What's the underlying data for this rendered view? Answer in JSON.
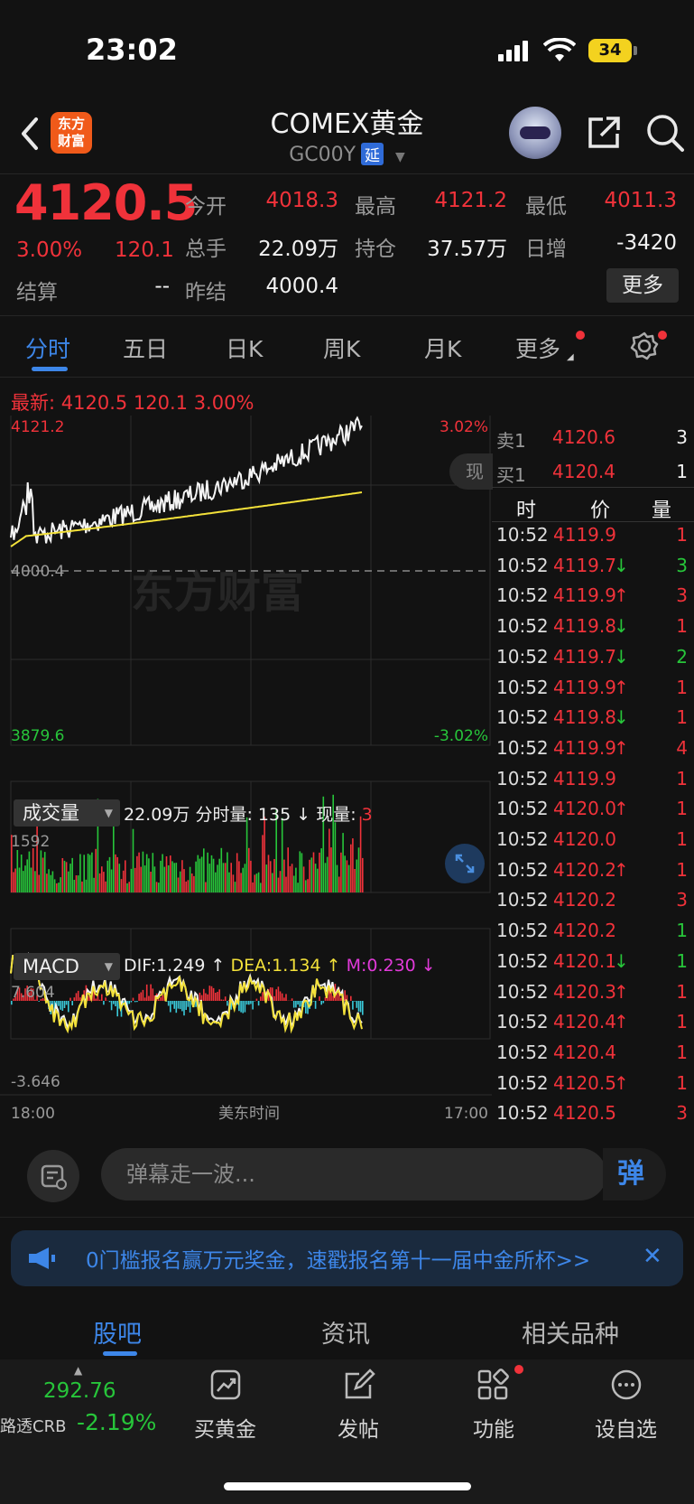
{
  "status": {
    "time": "23:02",
    "battery": "34"
  },
  "header": {
    "logo": "东方\n财富",
    "title": "COMEX黄金",
    "subtitle": "GC00Y",
    "delay_badge": "延"
  },
  "quote": {
    "price": "4120.5",
    "pct": "3.00%",
    "change": "120.1",
    "open_label": "今开",
    "open": "4018.3",
    "high_label": "最高",
    "high": "4121.2",
    "low_label": "最低",
    "low": "4011.3",
    "volume_label": "总手",
    "volume": "22.09万",
    "oi_label": "持仓",
    "oi": "37.57万",
    "daily_inc_label": "日增",
    "daily_inc": "-3420",
    "settle_label": "结算",
    "settle": "--",
    "prev_settle_label": "昨结",
    "prev_settle": "4000.4",
    "more": "更多"
  },
  "tabs": [
    "分时",
    "五日",
    "日K",
    "周K",
    "月K",
    "更多"
  ],
  "latest": "最新: 4120.5  120.1  3.00%",
  "chart_labels": {
    "y_top": "4121.2",
    "y_mid": "4000.4",
    "y_bot": "3879.6",
    "pct_top": "3.02%",
    "pct_bot": "-3.02%",
    "vol_max": "1592",
    "macd_top": "7.604",
    "macd_bot": "-3.646",
    "x_start": "18:00",
    "x_mid": "美东时间",
    "x_end": "17:00",
    "side_tag": "现"
  },
  "volume_header": {
    "tab": "成交量",
    "total": "22.09万",
    "tick_label": "分时量:",
    "tick": "135",
    "cur_label": "现量:",
    "cur": "3"
  },
  "macd_header": {
    "tab": "MACD",
    "dif": "DIF:1.249",
    "dea": "DEA:1.134",
    "m": "M:0.230"
  },
  "orderbook": {
    "ask_label": "卖1",
    "ask_price": "4120.6",
    "ask_qty": "3",
    "bid_label": "买1",
    "bid_price": "4120.4",
    "bid_qty": "1",
    "headers": [
      "时",
      "价",
      "量"
    ],
    "trades": [
      {
        "time": "10:52",
        "price": "4119.9",
        "arrow": "",
        "qty": "1",
        "qc": "red"
      },
      {
        "time": "10:52",
        "price": "4119.7",
        "arrow": "↓",
        "qty": "3",
        "qc": "green"
      },
      {
        "time": "10:52",
        "price": "4119.9",
        "arrow": "↑",
        "qty": "3",
        "qc": "red"
      },
      {
        "time": "10:52",
        "price": "4119.8",
        "arrow": "↓",
        "qty": "1",
        "qc": "red"
      },
      {
        "time": "10:52",
        "price": "4119.7",
        "arrow": "↓",
        "qty": "2",
        "qc": "green"
      },
      {
        "time": "10:52",
        "price": "4119.9",
        "arrow": "↑",
        "qty": "1",
        "qc": "red"
      },
      {
        "time": "10:52",
        "price": "4119.8",
        "arrow": "↓",
        "qty": "1",
        "qc": "red"
      },
      {
        "time": "10:52",
        "price": "4119.9",
        "arrow": "↑",
        "qty": "4",
        "qc": "red"
      },
      {
        "time": "10:52",
        "price": "4119.9",
        "arrow": "",
        "qty": "1",
        "qc": "red"
      },
      {
        "time": "10:52",
        "price": "4120.0",
        "arrow": "↑",
        "qty": "1",
        "qc": "red"
      },
      {
        "time": "10:52",
        "price": "4120.0",
        "arrow": "",
        "qty": "1",
        "qc": "red"
      },
      {
        "time": "10:52",
        "price": "4120.2",
        "arrow": "↑",
        "qty": "1",
        "qc": "red"
      },
      {
        "time": "10:52",
        "price": "4120.2",
        "arrow": "",
        "qty": "3",
        "qc": "red"
      },
      {
        "time": "10:52",
        "price": "4120.2",
        "arrow": "",
        "qty": "1",
        "qc": "green"
      },
      {
        "time": "10:52",
        "price": "4120.1",
        "arrow": "↓",
        "qty": "1",
        "qc": "green"
      },
      {
        "time": "10:52",
        "price": "4120.3",
        "arrow": "↑",
        "qty": "1",
        "qc": "red"
      },
      {
        "time": "10:52",
        "price": "4120.4",
        "arrow": "↑",
        "qty": "1",
        "qc": "red"
      },
      {
        "time": "10:52",
        "price": "4120.4",
        "arrow": "",
        "qty": "1",
        "qc": "red"
      },
      {
        "time": "10:52",
        "price": "4120.5",
        "arrow": "↑",
        "qty": "1",
        "qc": "red"
      },
      {
        "time": "10:52",
        "price": "4120.5",
        "arrow": "",
        "qty": "3",
        "qc": "red"
      }
    ]
  },
  "watermark": "东方财富",
  "danmu": {
    "placeholder": "弹幕走一波...",
    "toggle": "弹"
  },
  "promo": {
    "text": "0门槛报名赢万元奖金，速戳报名第十一届中金所杯>>"
  },
  "bottom_tabs": [
    "股吧",
    "资讯",
    "相关品种"
  ],
  "bottom_nav": {
    "ticker_value": "292.76",
    "ticker_name": "路透CRB",
    "ticker_pct": "-2.19%",
    "items": [
      "买黄金",
      "发帖",
      "功能",
      "设自选"
    ]
  },
  "colors": {
    "up": "#f0323a",
    "down": "#27c53a",
    "accent": "#3d86e8",
    "avg_line": "#f3e13a"
  }
}
